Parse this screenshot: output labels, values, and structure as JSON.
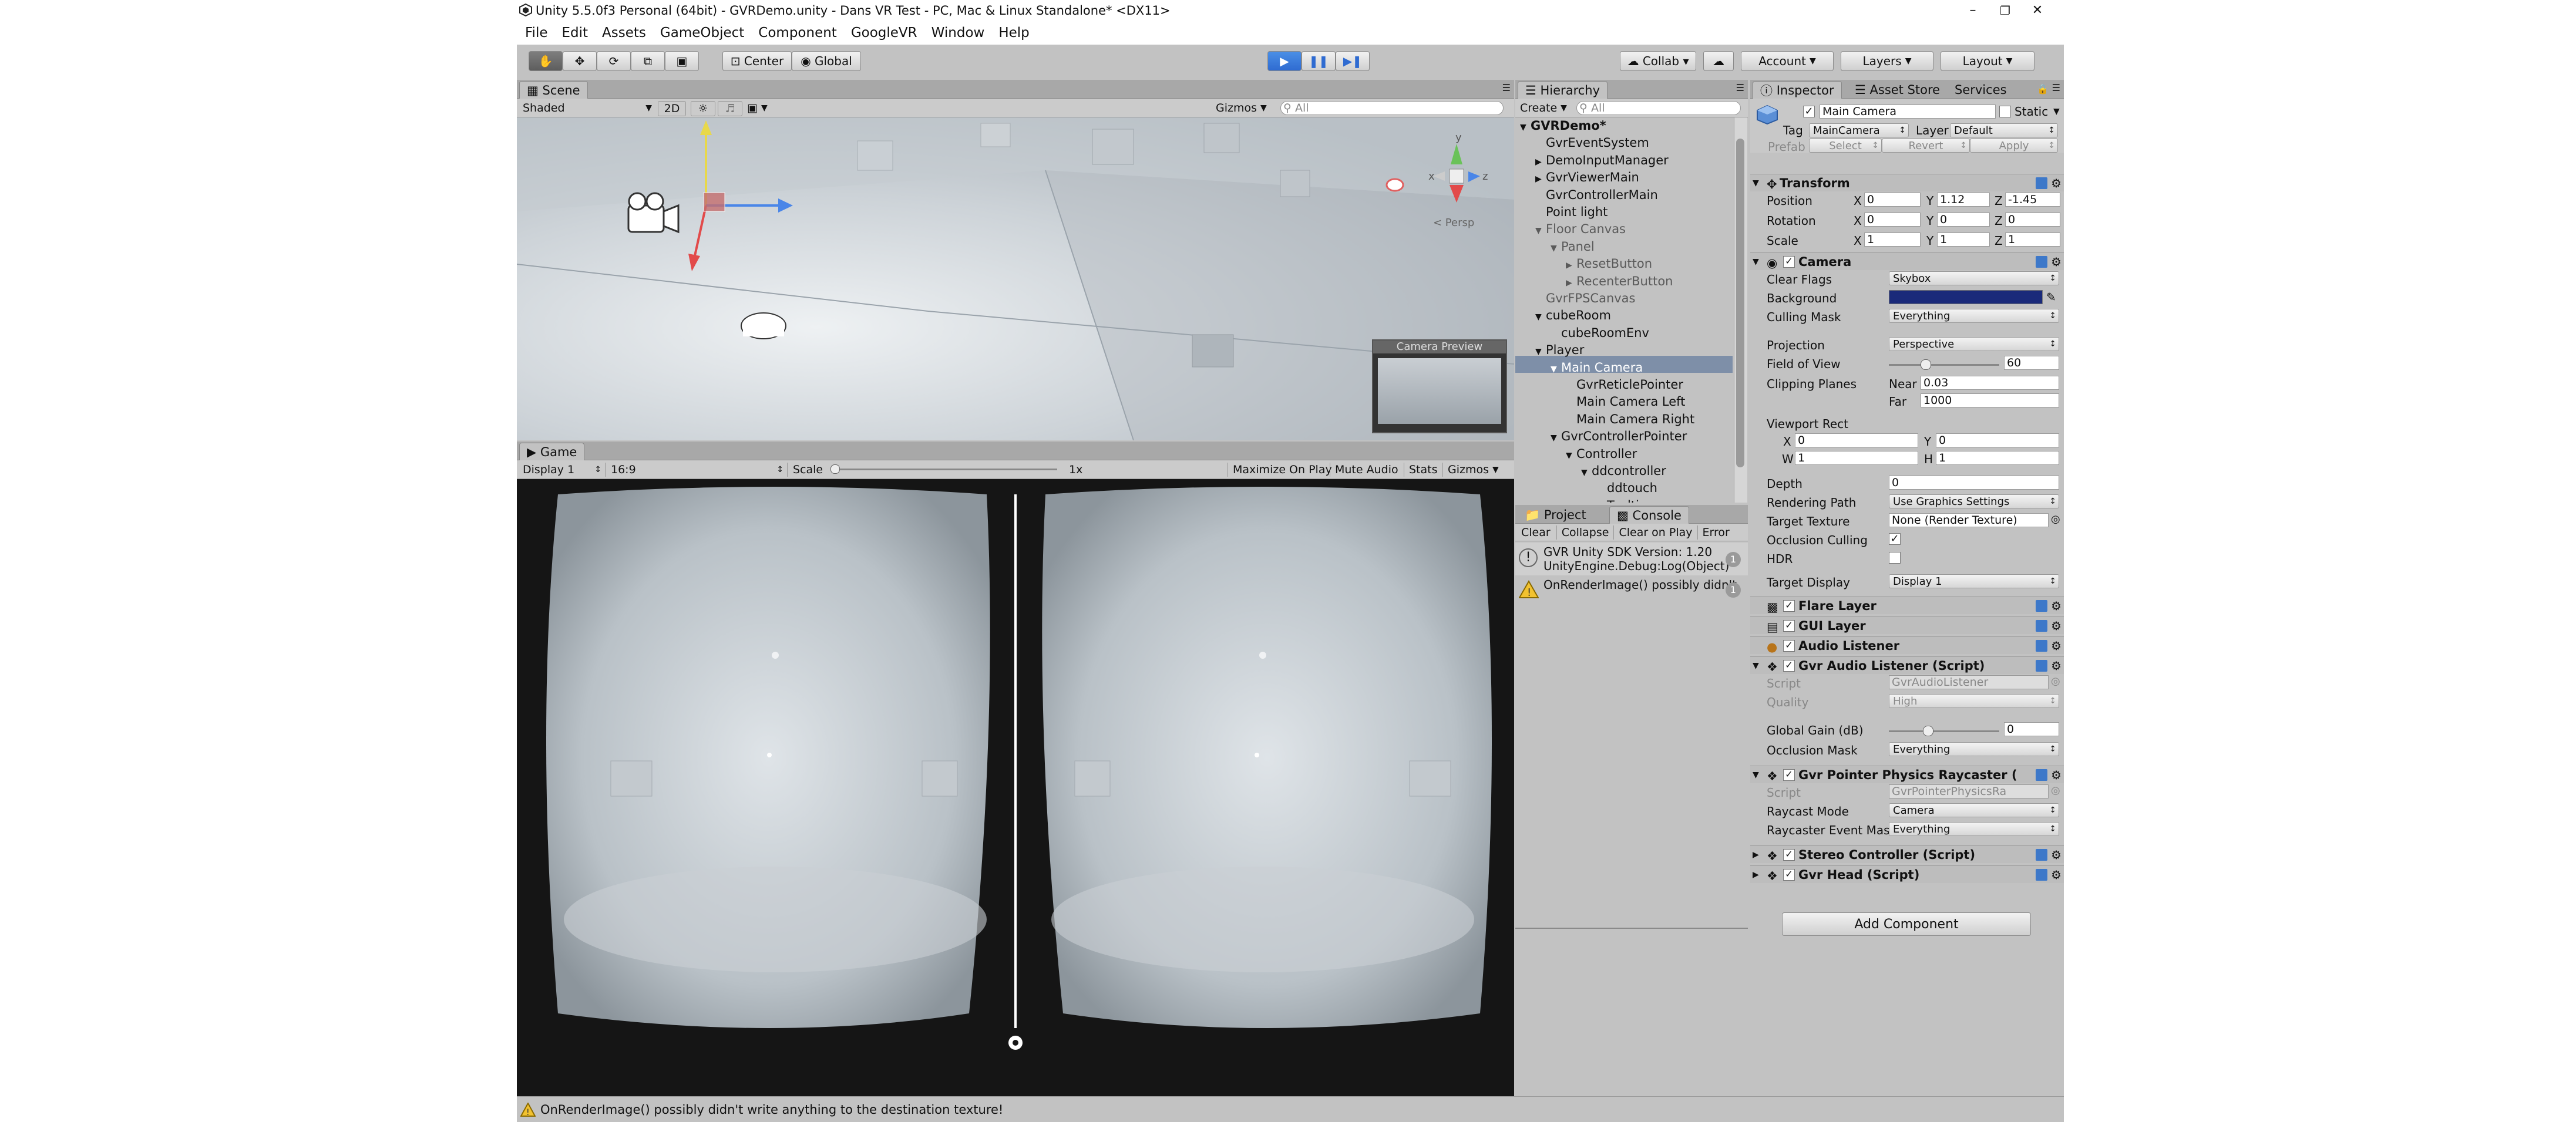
{
  "window": {
    "title": "Unity 5.5.0f3 Personal (64bit) - GVRDemo.unity - Dans VR Test - PC, Mac & Linux Standalone* <DX11>",
    "minimize": "–",
    "maximize": "❐",
    "close": "✕"
  },
  "menu": [
    "File",
    "Edit",
    "Assets",
    "GameObject",
    "Component",
    "GoogleVR",
    "Window",
    "Help"
  ],
  "toolbar": {
    "center": "Center",
    "global": "Global",
    "collab": "Collab ▾",
    "account": "Account",
    "layers": "Layers",
    "layout": "Layout"
  },
  "scene": {
    "tab": "Scene",
    "shading": "Shaded",
    "mode_2d": "2D",
    "gizmos": "Gizmos",
    "search_placeholder": "All",
    "persp": "< Persp",
    "gizmo_y": "y",
    "gizmo_x": "x",
    "gizmo_z": "z",
    "camera_preview": "Camera Preview"
  },
  "game": {
    "tab": "Game",
    "display": "Display 1",
    "aspect": "16:9",
    "scale_label": "Scale",
    "scale_value": "1x",
    "maximize": "Maximize On Play",
    "mute": "Mute Audio",
    "stats": "Stats",
    "gizmos": "Gizmos"
  },
  "hierarchy": {
    "tab": "Hierarchy",
    "create": "Create",
    "search_placeholder": "All",
    "items": [
      {
        "label": "GVRDemo*",
        "indent": 0,
        "tri": "▼"
      },
      {
        "label": "GvrEventSystem",
        "indent": 1,
        "tri": ""
      },
      {
        "label": "DemoInputManager",
        "indent": 1,
        "tri": "▶"
      },
      {
        "label": "GvrViewerMain",
        "indent": 1,
        "tri": "▶"
      },
      {
        "label": "GvrControllerMain",
        "indent": 1,
        "tri": ""
      },
      {
        "label": "Point light",
        "indent": 1,
        "tri": ""
      },
      {
        "label": "Floor Canvas",
        "indent": 1,
        "tri": "▼"
      },
      {
        "label": "Panel",
        "indent": 2,
        "tri": "▼"
      },
      {
        "label": "ResetButton",
        "indent": 3,
        "tri": "▶"
      },
      {
        "label": "RecenterButton",
        "indent": 3,
        "tri": "▶"
      },
      {
        "label": "GvrFPSCanvas",
        "indent": 1,
        "tri": ""
      },
      {
        "label": "cubeRoom",
        "indent": 1,
        "tri": "▼"
      },
      {
        "label": "cubeRoomEnv",
        "indent": 2,
        "tri": ""
      },
      {
        "label": "Player",
        "indent": 1,
        "tri": "▼"
      },
      {
        "label": "Main Camera",
        "indent": 2,
        "tri": "▼"
      },
      {
        "label": "GvrReticlePointer",
        "indent": 3,
        "tri": ""
      },
      {
        "label": "Main Camera Left",
        "indent": 3,
        "tri": ""
      },
      {
        "label": "Main Camera Right",
        "indent": 3,
        "tri": ""
      },
      {
        "label": "GvrControllerPointer",
        "indent": 2,
        "tri": "▼"
      },
      {
        "label": "Controller",
        "indent": 3,
        "tri": "▼"
      },
      {
        "label": "ddcontroller",
        "indent": 4,
        "tri": "▼"
      },
      {
        "label": "ddtouch",
        "indent": 5,
        "tri": ""
      },
      {
        "label": "Tooltips",
        "indent": 5,
        "tri": "▶"
      }
    ]
  },
  "console": {
    "tab_project": "Project",
    "tab_console": "Console",
    "clear": "Clear",
    "collapse": "Collapse",
    "clear_on_play": "Clear on Play",
    "error_pause": "Error",
    "messages": [
      {
        "line1": "GVR Unity SDK Version: 1.20",
        "line2": "UnityEngine.Debug:Log(Object)",
        "count": "1"
      },
      {
        "line1": "OnRenderImage() possibly didn't",
        "line2": "",
        "count": "1"
      }
    ]
  },
  "inspector": {
    "tab": "Inspector",
    "tab_asset_store": "Asset Store",
    "tab_services": "Services",
    "name": "Main Camera",
    "static": "Static",
    "tag_label": "Tag",
    "tag": "MainCamera",
    "layer_label": "Layer",
    "layer": "Default",
    "prefab": "Prefab",
    "select": "Select",
    "revert": "Revert",
    "apply": "Apply",
    "transform": {
      "title": "Transform",
      "position": {
        "label": "Position",
        "x": "0",
        "y": "1.12",
        "z": "-1.45"
      },
      "rotation": {
        "label": "Rotation",
        "x": "0",
        "y": "0",
        "z": "0"
      },
      "scale": {
        "label": "Scale",
        "x": "1",
        "y": "1",
        "z": "1"
      }
    },
    "camera": {
      "title": "Camera",
      "clear_flags_label": "Clear Flags",
      "clear_flags": "Skybox",
      "background_label": "Background",
      "background_color": "#1a2a7a",
      "culling_mask_label": "Culling Mask",
      "culling_mask": "Everything",
      "projection_label": "Projection",
      "projection": "Perspective",
      "fov_label": "Field of View",
      "fov": "60",
      "fov_fraction": 0.33,
      "clipping_label": "Clipping Planes",
      "near_label": "Near",
      "near": "0.03",
      "far_label": "Far",
      "far": "1000",
      "viewport_label": "Viewport Rect",
      "vx": "0",
      "vy": "0",
      "vw": "1",
      "vh": "1",
      "depth_label": "Depth",
      "depth": "0",
      "rendering_path_label": "Rendering Path",
      "rendering_path": "Use Graphics Settings",
      "target_texture_label": "Target Texture",
      "target_texture": "None (Render Texture)",
      "occlusion_label": "Occlusion Culling",
      "hdr_label": "HDR",
      "target_display_label": "Target Display",
      "target_display": "Display 1"
    },
    "flare_layer": "Flare Layer",
    "gui_layer": "GUI Layer",
    "audio_listener": "Audio Listener",
    "gvr_audio": {
      "title": "Gvr Audio Listener (Script)",
      "script_label": "Script",
      "script": "GvrAudioListener",
      "quality_label": "Quality",
      "quality": "High",
      "gain_label": "Global Gain (dB)",
      "gain": "0",
      "gain_fraction": 0.35,
      "occlusion_label": "Occlusion Mask",
      "occlusion": "Everything"
    },
    "gvr_raycaster": {
      "title": "Gvr Pointer Physics Raycaster (",
      "script_label": "Script",
      "script": "GvrPointerPhysicsRa",
      "raycast_label": "Raycast Mode",
      "raycast": "Camera",
      "event_mask_label": "Raycaster Event Mas",
      "event_mask": "Everything"
    },
    "stereo_controller": "Stereo Controller (Script)",
    "gvr_head": "Gvr Head (Script)",
    "add_component": "Add Component"
  },
  "status": {
    "message": "OnRenderImage() possibly didn't write anything to the destination texture!"
  },
  "colors": {
    "accent": "#3d78c9",
    "play": "#2f6bd1",
    "selection": "#7e8fa8"
  }
}
